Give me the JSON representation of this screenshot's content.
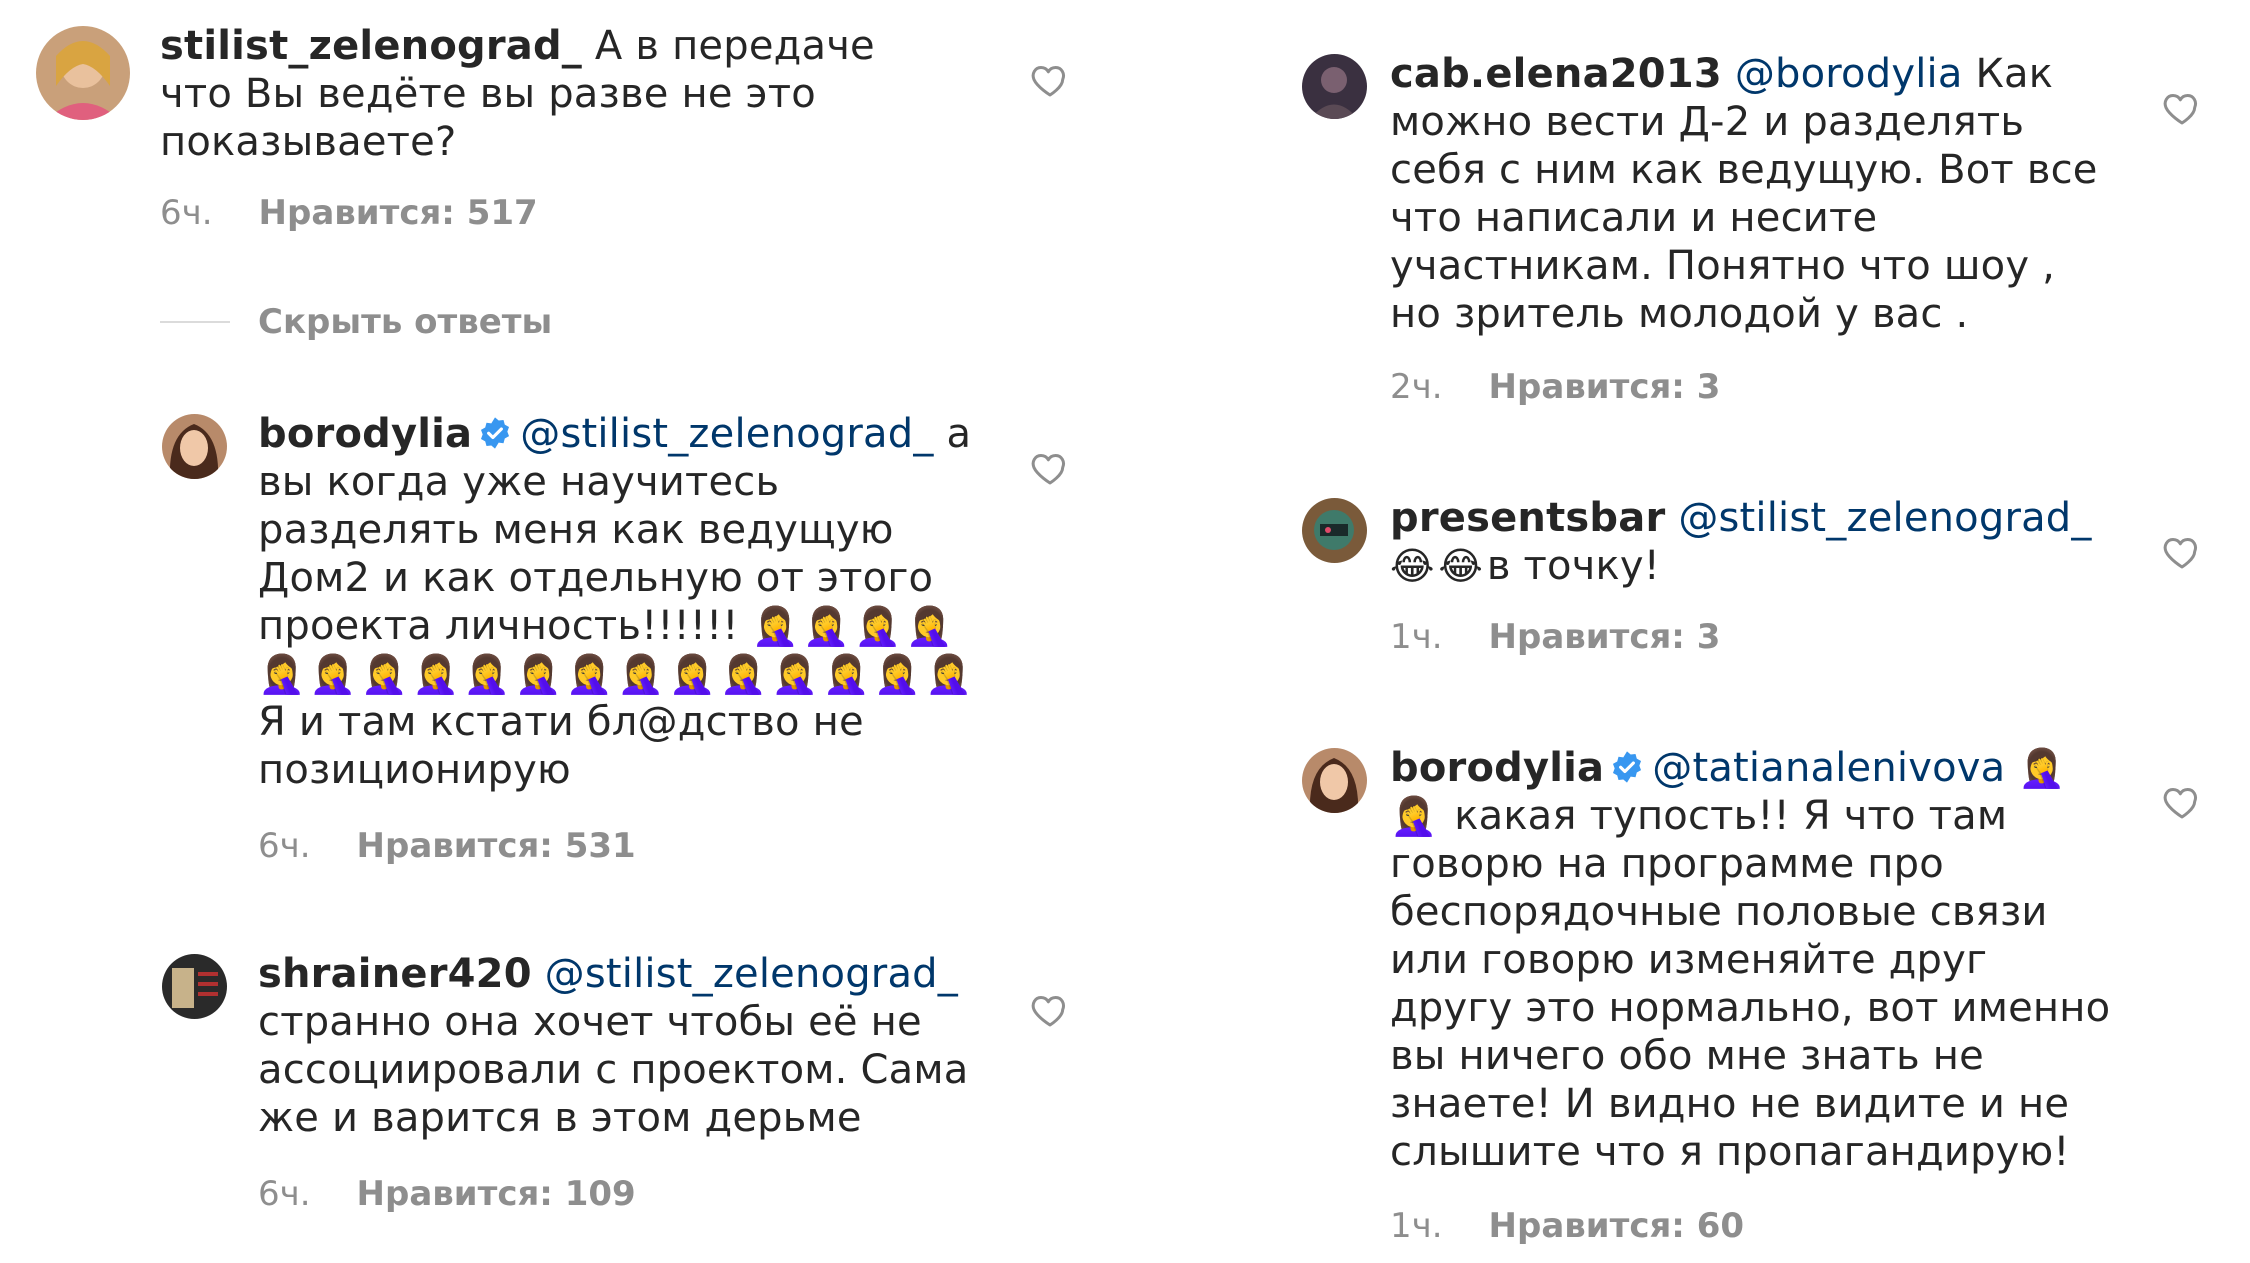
{
  "left_column": {
    "top_comment": {
      "username": "stilist_zelenograd_",
      "text": "А в передаче что Вы ведёте вы разве не это показываете?",
      "time": "6ч.",
      "likes": "Нравится: 517"
    },
    "hide_replies_label": "Скрыть ответы",
    "replies": [
      {
        "username": "borodylia",
        "verified": true,
        "mention": "@stilist_zelenograd_",
        "text_part1": "а вы когда уже научитесь разделять меня как ведущую Дом2 и как отдельную от этого проекта личность!!!!!!",
        "emoji_part": "🤦‍♀️🤦‍♀️🤦‍♀️🤦‍♀️🤦‍♀️🤦‍♀️🤦‍♀️🤦‍♀️🤦‍♀️🤦‍♀️🤦‍♀️🤦‍♀️🤦‍♀️🤦‍♀️🤦‍♀️🤦‍♀️🤦‍♀️🤦‍♀️",
        "text_part2": "Я и там кстати бл@дство не позиционирую",
        "time": "6ч.",
        "likes": "Нравится: 531"
      },
      {
        "username": "shrainer420",
        "mention": "@stilist_zelenograd_",
        "text": "странно она хочет чтобы её не ассоциировали с проектом. Сама же и варится в этом дерьме",
        "time": "6ч.",
        "likes": "Нравится: 109"
      }
    ]
  },
  "right_column": {
    "replies": [
      {
        "username": "cab.elena2013",
        "mention": "@borodylia",
        "text": "Как можно вести Д-2 и разделять себя с ним как ведущую. Вот все что написали и несите участникам. Понятно что шоу , но зритель молодой у вас .",
        "time": "2ч.",
        "likes": "Нравится: 3"
      },
      {
        "username": "presentsbar",
        "mention": "@stilist_zelenograd_",
        "emoji": "😂😂",
        "text": "в точку!",
        "time": "1ч.",
        "likes": "Нравится: 3"
      },
      {
        "username": "borodylia",
        "verified": true,
        "mention": "@tatianalenivova",
        "emoji": "🤦‍♀️🤦‍♀️",
        "text": "какая тупость!! Я что там говорю на программе про беспорядочные половые связи или говорю изменяйте друг другу это нормально, вот именно вы ничего обо мне знать не знаете! И видно не видите и не слышите что я пропагандирую!",
        "time": "1ч.",
        "likes": "Нравится: 60"
      }
    ]
  },
  "colors": {
    "text": "#262626",
    "mention": "#00376b",
    "meta": "#8e8e8e",
    "verified": "#3897f0",
    "divider": "#dbdbdb"
  }
}
